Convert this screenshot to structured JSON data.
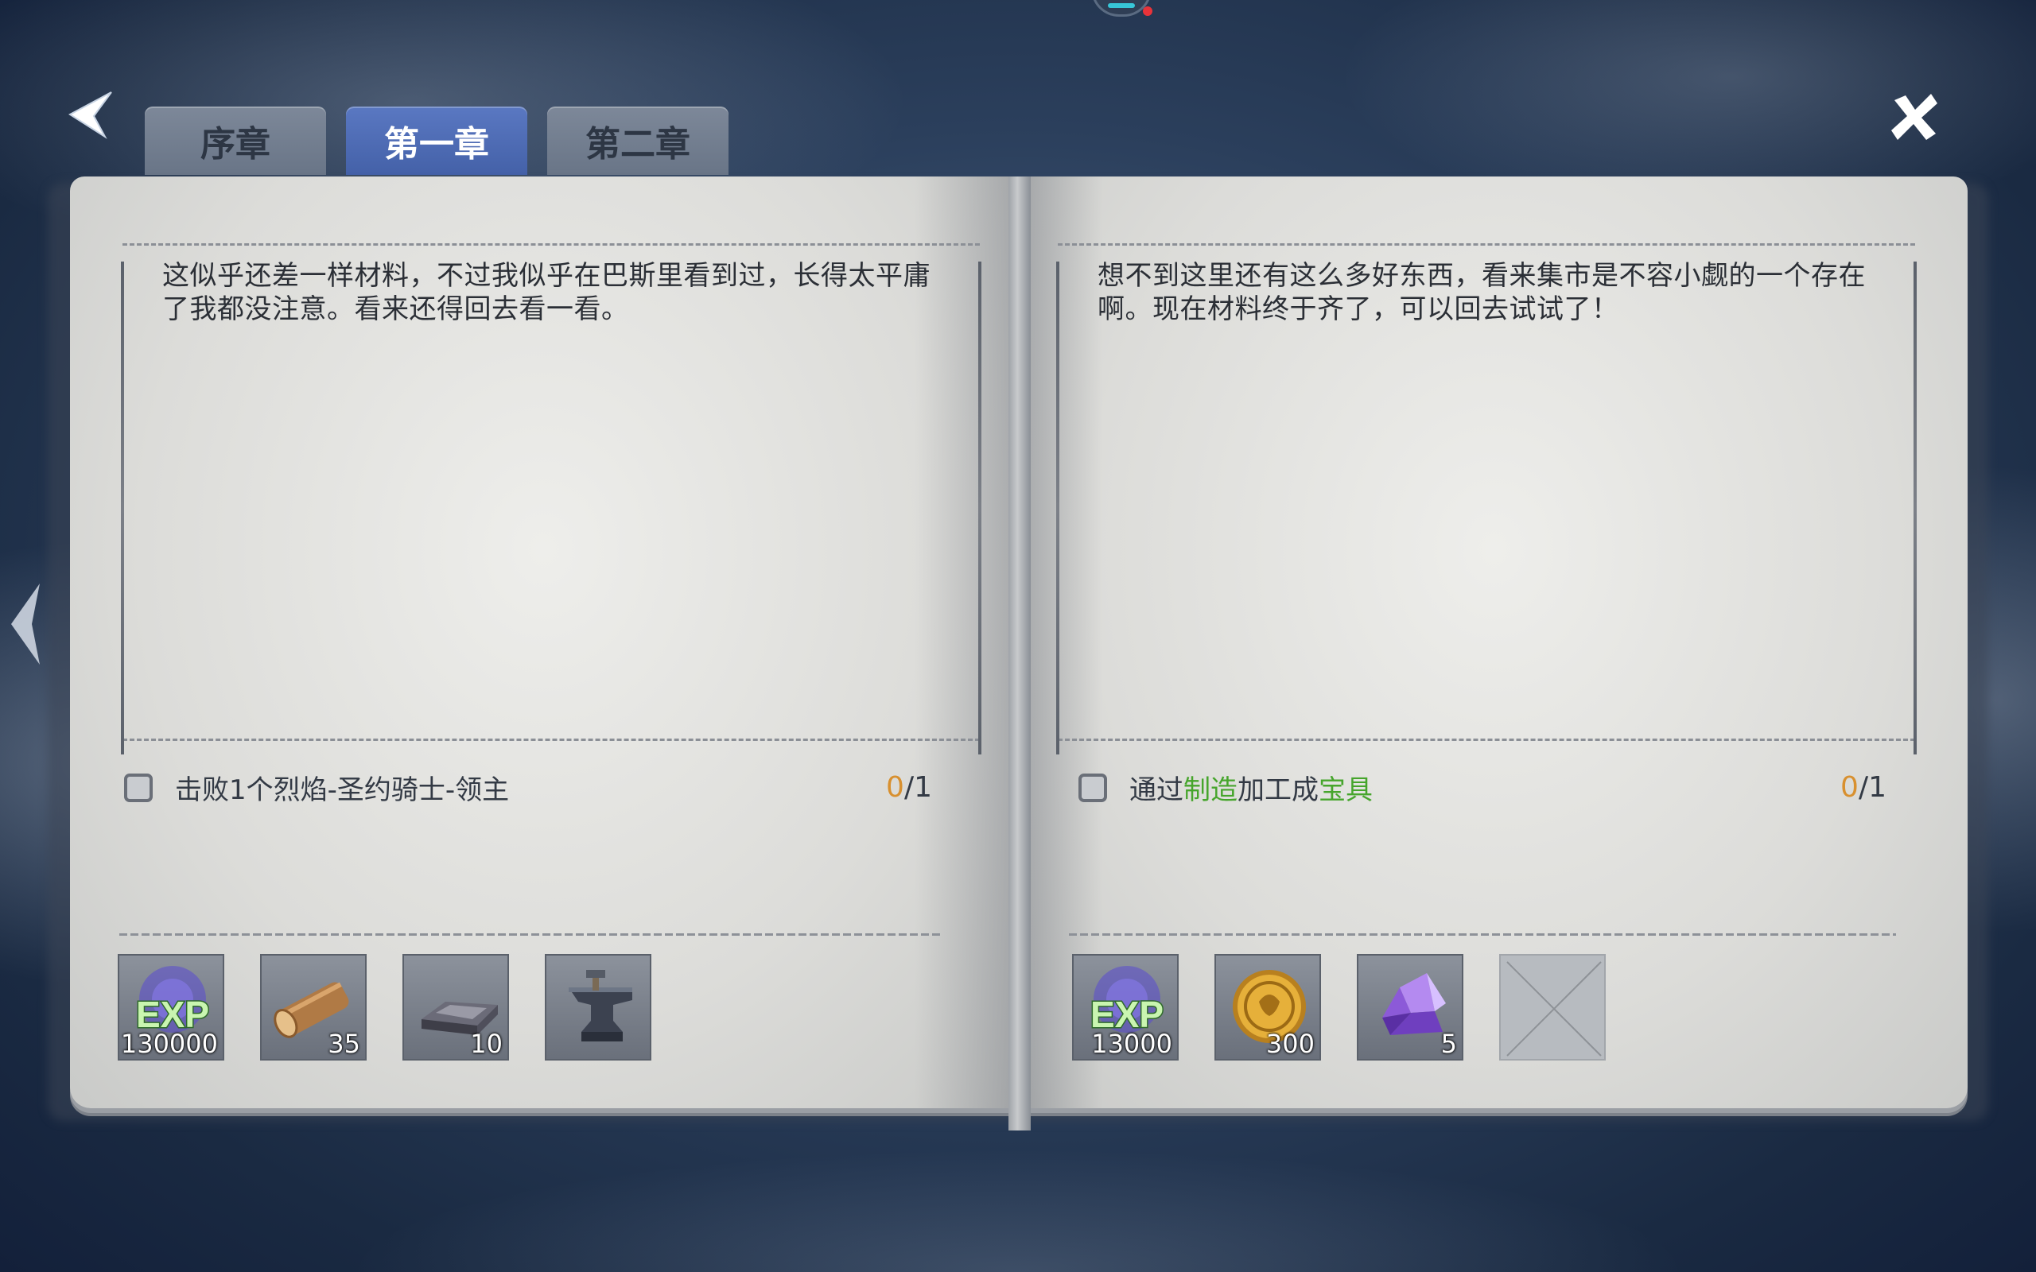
{
  "tabs": [
    {
      "label": "序章",
      "active": false
    },
    {
      "label": "第一章",
      "active": true
    },
    {
      "label": "第二章",
      "active": false
    }
  ],
  "left_page": {
    "story": "这似乎还差一样材料，不过我似乎在巴斯里看到过，长得太平庸了我都没注意。看来还得回去看一看。",
    "quest": {
      "text": "击败1个烈焰-圣约骑士-领主",
      "progress_current": "0",
      "progress_total": "/1"
    },
    "rewards": [
      {
        "icon": "exp-icon",
        "count": "130000"
      },
      {
        "icon": "wood-log-icon",
        "count": "35"
      },
      {
        "icon": "iron-ingot-icon",
        "count": "10"
      },
      {
        "icon": "anvil-icon",
        "count": ""
      }
    ]
  },
  "right_page": {
    "story": "想不到这里还有这么多好东西，看来集市是不容小觑的一个存在啊。现在材料终于齐了，可以回去试试了！",
    "quest": {
      "text_1": "通过",
      "highlight_1": "制造",
      "text_2": "加工成",
      "highlight_2": "宝具",
      "progress_current": "0",
      "progress_total": "/1"
    },
    "rewards": [
      {
        "icon": "exp-icon",
        "count": "13000"
      },
      {
        "icon": "gold-coin-icon",
        "count": "300"
      },
      {
        "icon": "purple-crystal-icon",
        "count": "5"
      },
      {
        "icon": "empty-slot-icon",
        "count": ""
      }
    ]
  },
  "colors": {
    "tab_active": "#4d6ab5",
    "tab_inactive": "#737f91",
    "highlight_green": "#46a52c",
    "progress_orange": "#d8902f"
  }
}
